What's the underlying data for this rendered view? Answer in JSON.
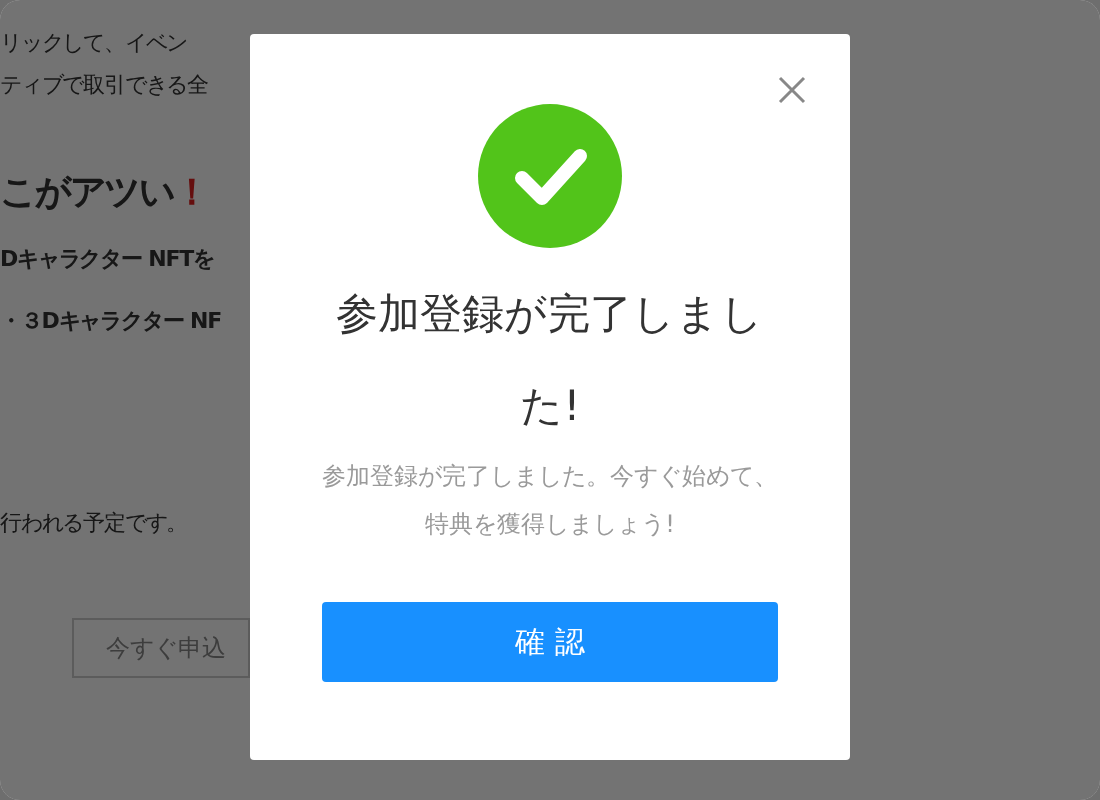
{
  "background_page": {
    "lines": [
      {
        "kind": "text",
        "text": "リックして、イベン"
      },
      {
        "kind": "text",
        "text": "ティブで取引できる全"
      },
      {
        "kind": "heading",
        "text": "こがアツい",
        "mark": "！"
      },
      {
        "kind": "bullet",
        "text": "Dキャラクター NFTを"
      },
      {
        "kind": "bullet",
        "text": "・３Dキャラクター NF"
      },
      {
        "kind": "note",
        "text": "行われる予定です。"
      },
      {
        "kind": "button",
        "text": "今すぐ申込"
      }
    ]
  },
  "modal": {
    "success": true,
    "title": "参加登録が完了しました!",
    "message": "参加登録が完了しました。今すぐ始めて、特典を獲得しましょう!",
    "confirm_button": "確 認"
  }
}
